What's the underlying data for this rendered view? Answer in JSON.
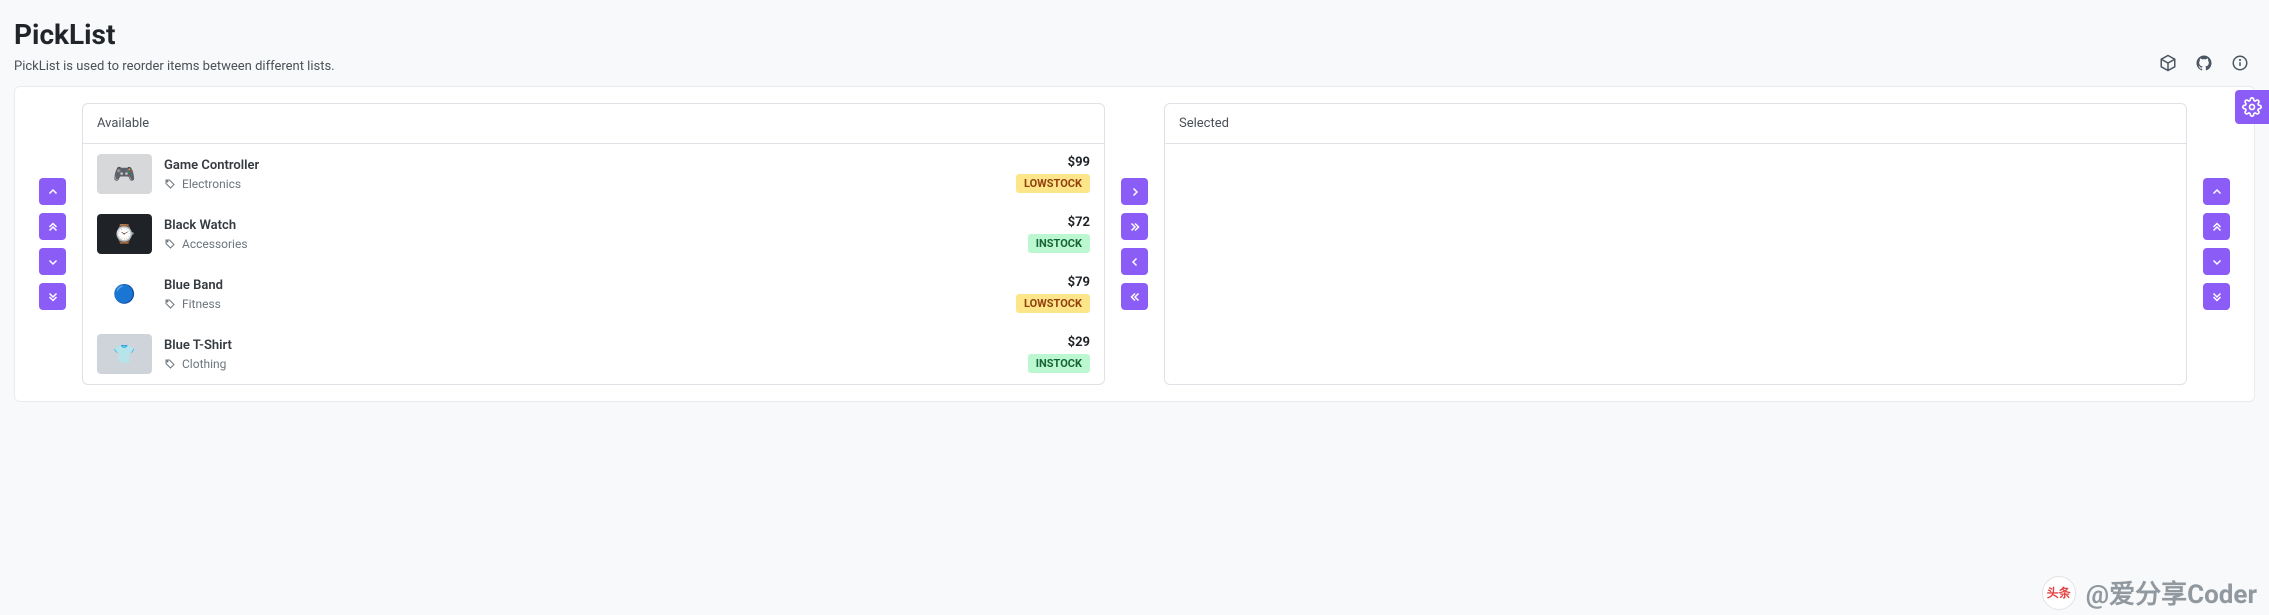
{
  "header": {
    "title": "PickList",
    "subtitle": "PickList is used to reorder items between different lists."
  },
  "picklist": {
    "source_header": "Available",
    "target_header": "Selected",
    "source": [
      {
        "name": "Game Controller",
        "category": "Electronics",
        "price": "$99",
        "status": "LOWSTOCK",
        "thumb_tint": "#d6d8da",
        "thumb_glyph": "🎮"
      },
      {
        "name": "Black Watch",
        "category": "Accessories",
        "price": "$72",
        "status": "INSTOCK",
        "thumb_tint": "#1f2327",
        "thumb_glyph": "⌚"
      },
      {
        "name": "Blue Band",
        "category": "Fitness",
        "price": "$79",
        "status": "LOWSTOCK",
        "thumb_tint": "#ffffff",
        "thumb_glyph": "🔵"
      },
      {
        "name": "Blue T-Shirt",
        "category": "Clothing",
        "price": "$29",
        "status": "INSTOCK",
        "thumb_tint": "#ced4da",
        "thumb_glyph": "👕"
      }
    ],
    "target": []
  },
  "watermark": {
    "logo_text": "头条",
    "text": "@爱分享Coder"
  }
}
